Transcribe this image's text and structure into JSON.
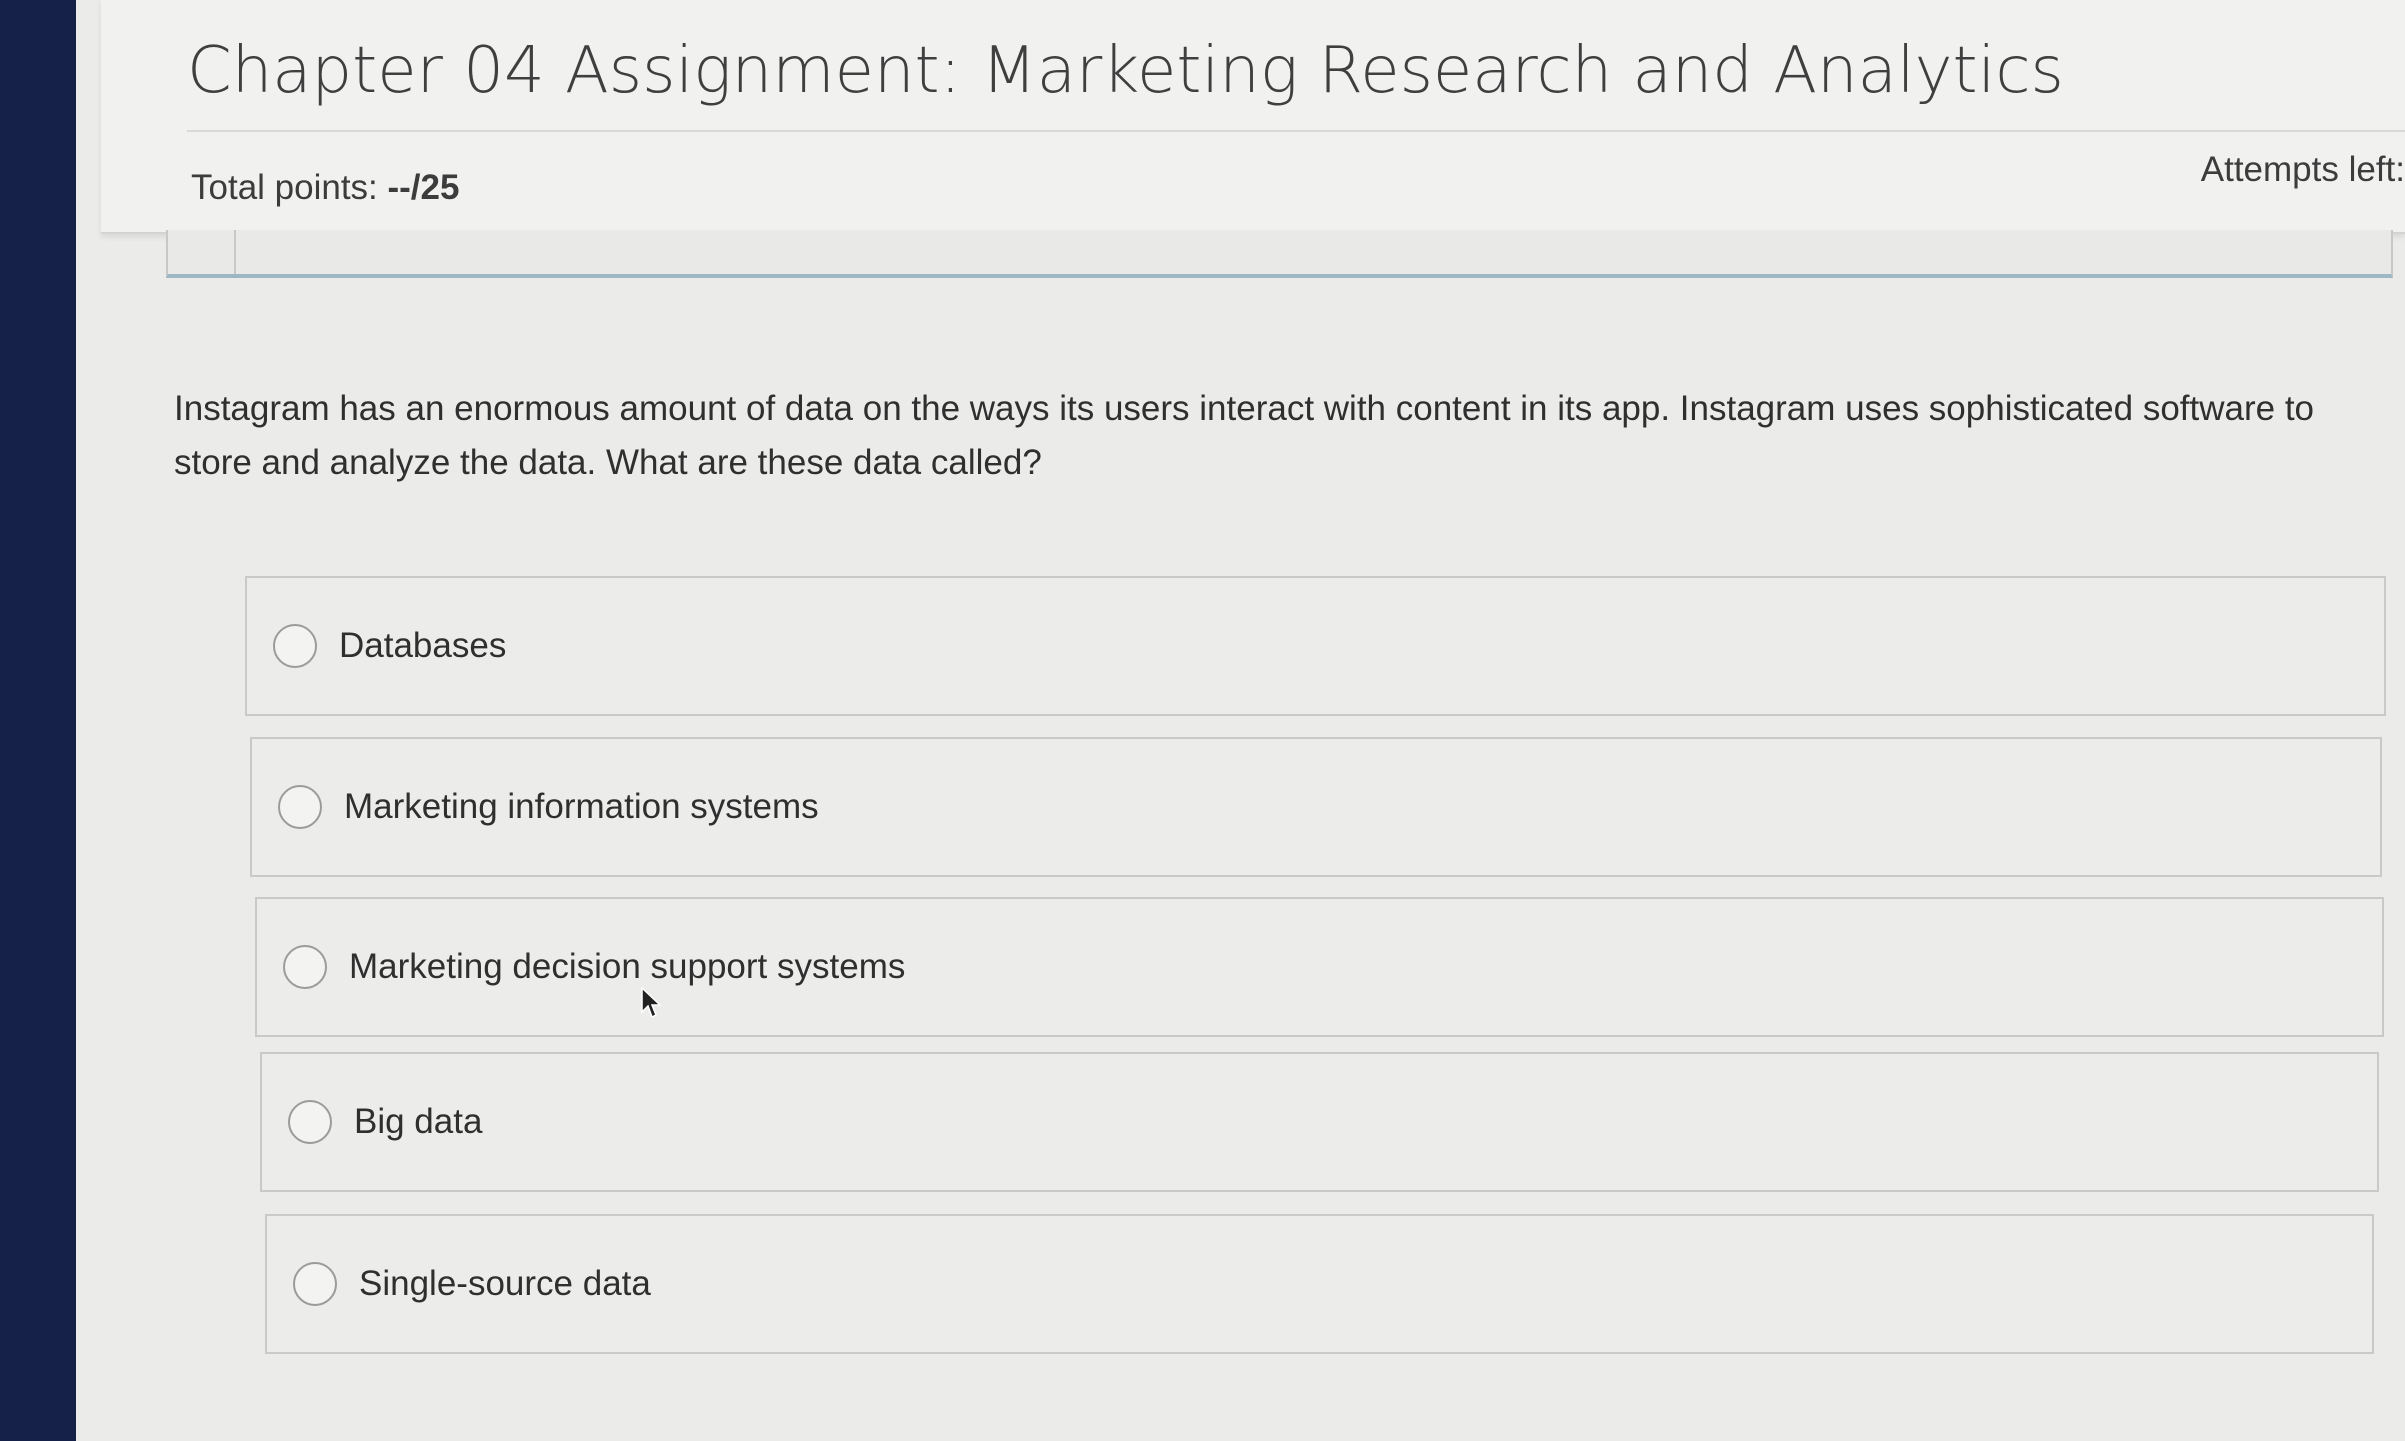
{
  "header": {
    "title": "Chapter 04 Assignment: Marketing Research and Analytics",
    "points_label": "Total points: ",
    "points_value": "--/25",
    "attempts_label": "Attempts left:"
  },
  "question": {
    "text": "Instagram has an enormous amount of data on the ways its users interact with content in its app. Instagram uses sophisticated software to store and analyze the data. What are these data called?"
  },
  "options": [
    {
      "label": "Databases",
      "selected": false
    },
    {
      "label": "Marketing information systems",
      "selected": false
    },
    {
      "label": "Marketing decision support systems",
      "selected": false
    },
    {
      "label": "Big data",
      "selected": false
    },
    {
      "label": "Single-source data",
      "selected": false
    }
  ],
  "colors": {
    "sidebar": "#16214a",
    "tab_underline": "#9eb7c7"
  }
}
